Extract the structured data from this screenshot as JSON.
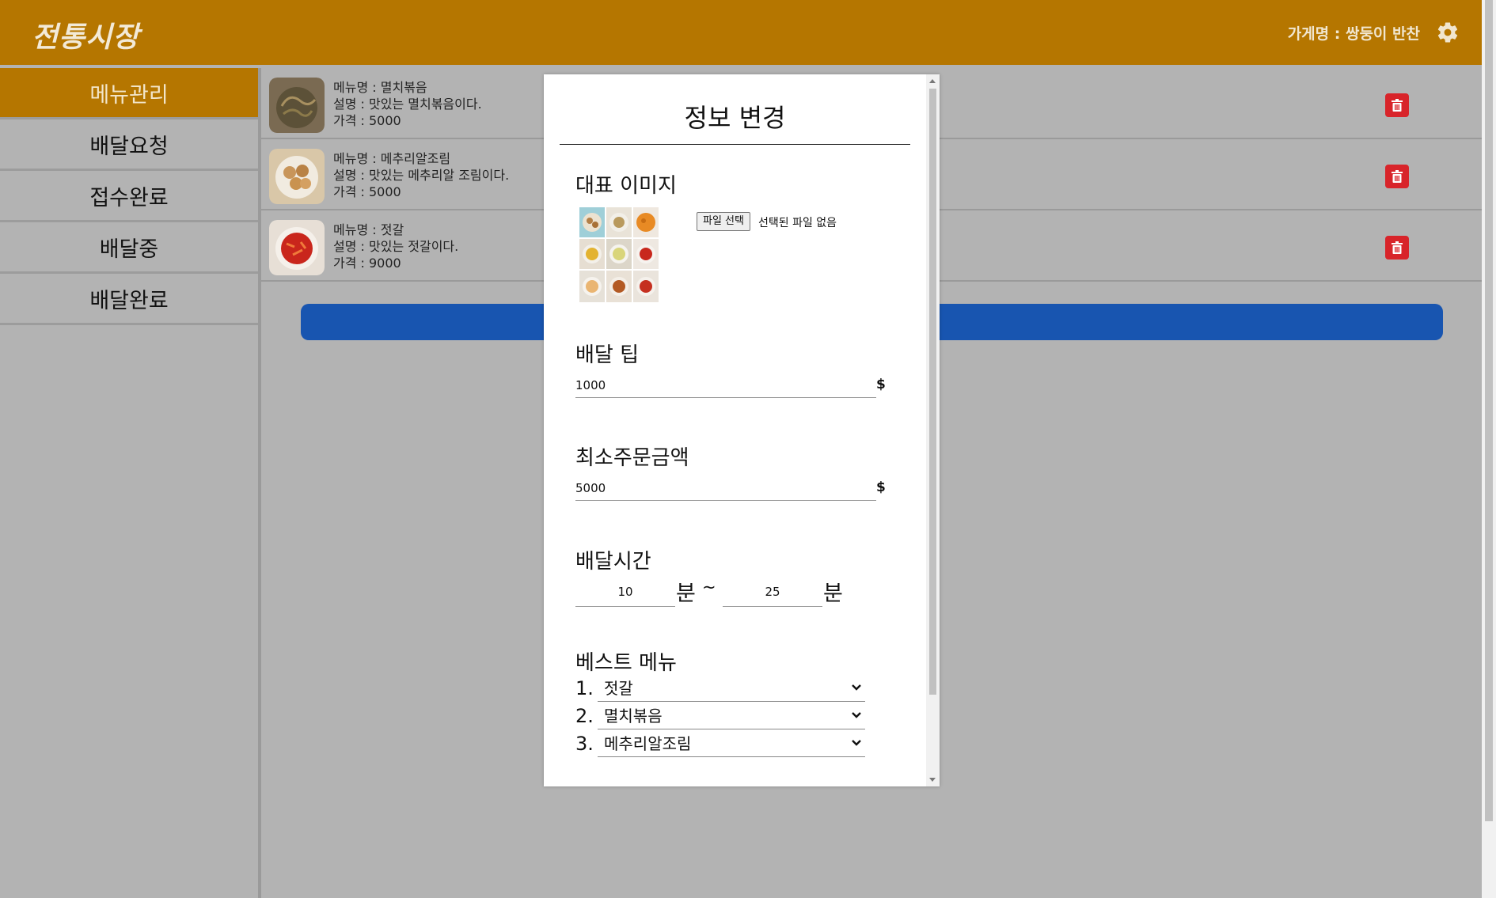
{
  "header": {
    "logo": "전통시장",
    "store_label": "가게명 : 쌍둥이 반찬"
  },
  "colors": {
    "brand": "#b57600",
    "danger": "#d8242a",
    "primary": "#1855b0"
  },
  "sidebar": {
    "items": [
      {
        "label": "메뉴관리",
        "active": true
      },
      {
        "label": "배달요청",
        "active": false
      },
      {
        "label": "접수완료",
        "active": false
      },
      {
        "label": "배달중",
        "active": false
      },
      {
        "label": "배달완료",
        "active": false
      }
    ]
  },
  "menus": [
    {
      "name": "메뉴명 : 멸치볶음",
      "desc": "설명 : 맛있는 멸치볶음이다.",
      "price": "가격 : 5000"
    },
    {
      "name": "메뉴명 : 메추리알조림",
      "desc": "설명 : 맛있는 메추리알 조림이다.",
      "price": "가격 : 5000"
    },
    {
      "name": "메뉴명 : 젓갈",
      "desc": "설명 : 맛있는 젓갈이다.",
      "price": "가격 : 9000"
    }
  ],
  "modal": {
    "title": "정보 변경",
    "rep_image_label": "대표 이미지",
    "file_button": "파일 선택",
    "file_status": "선택된 파일 없음",
    "delivery_tip_label": "배달 팁",
    "delivery_tip_value": "1000",
    "min_order_label": "최소주문금액",
    "min_order_value": "5000",
    "currency": "$",
    "delivery_time_label": "배달시간",
    "time_from": "10",
    "time_to": "25",
    "minute_unit": "분",
    "tilde": "~",
    "best_menu_label": "베스트 메뉴",
    "best_menu": [
      {
        "num": "1.",
        "value": "젓갈"
      },
      {
        "num": "2.",
        "value": "멸치볶음"
      },
      {
        "num": "3.",
        "value": "메추리알조림"
      }
    ]
  }
}
